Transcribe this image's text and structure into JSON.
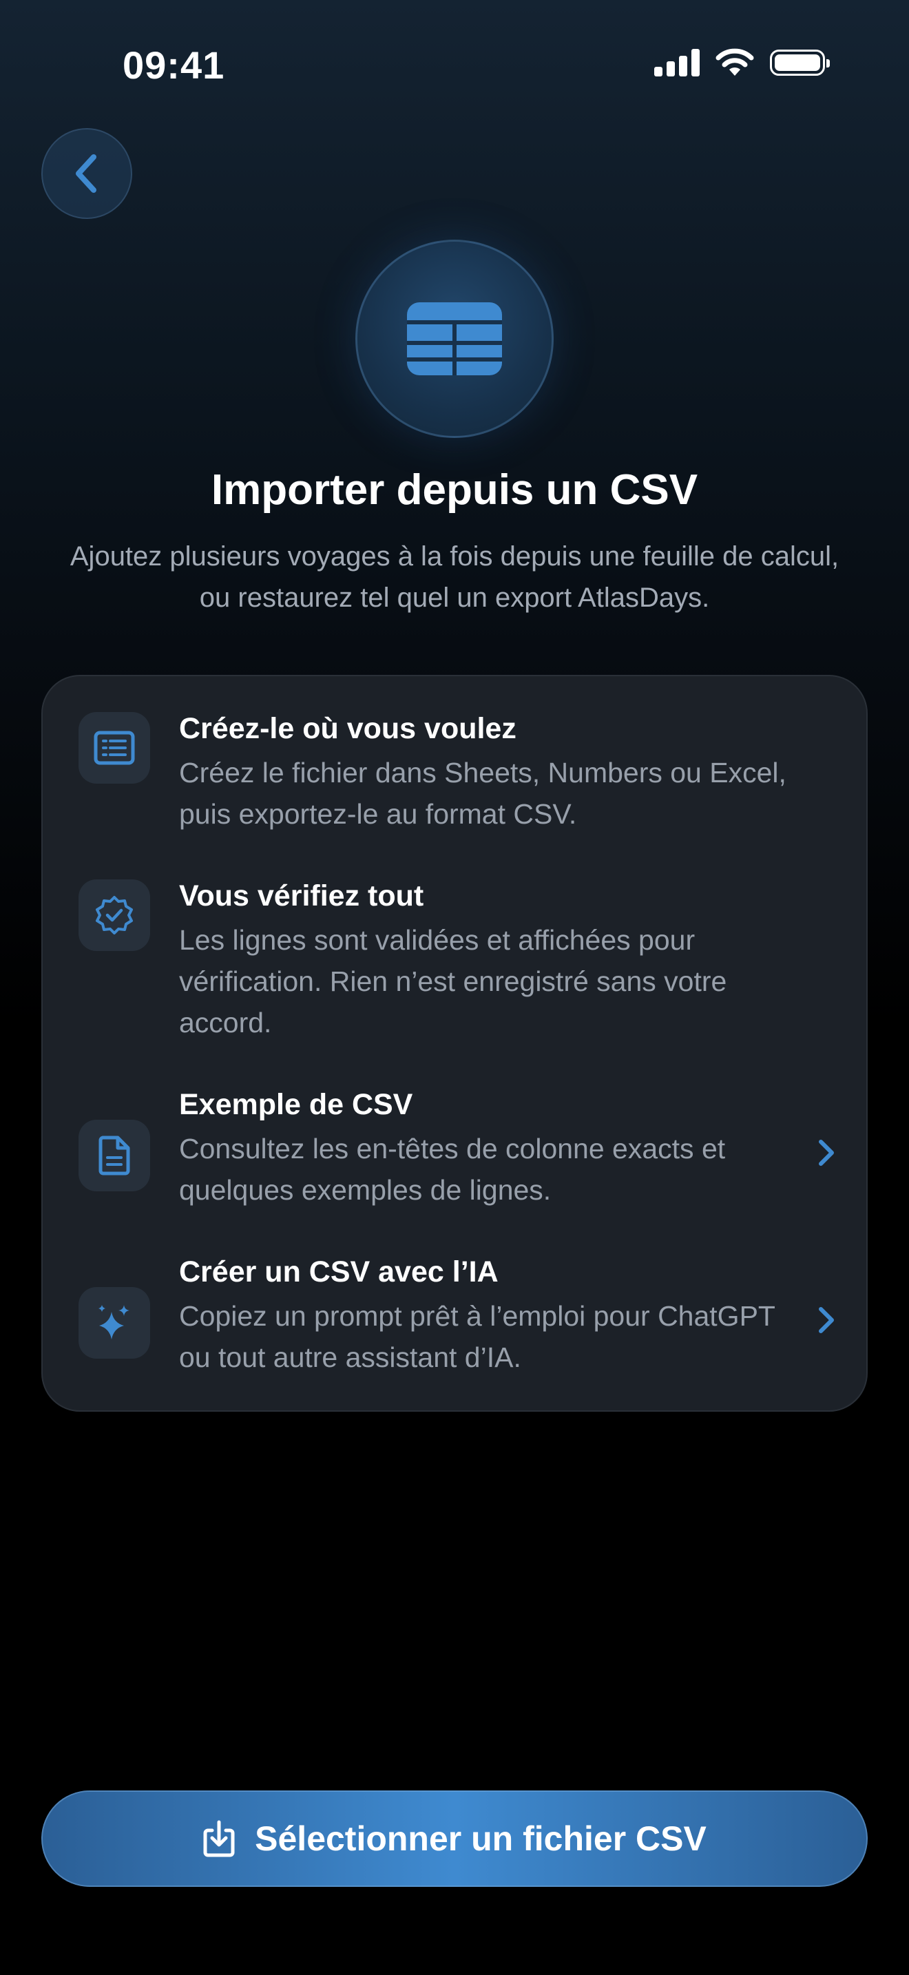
{
  "status_bar": {
    "time": "09:41"
  },
  "header": {
    "title": "Importer depuis un CSV",
    "subtitle": "Ajoutez plusieurs voyages à la fois depuis une feuille de calcul, ou restaurez tel quel un export AtlasDays."
  },
  "card": {
    "items": [
      {
        "title": "Créez-le où vous voulez",
        "description": "Créez le fichier dans Sheets, Numbers ou Excel, puis exportez-le au format CSV.",
        "icon": "list-document-icon",
        "has_chevron": false
      },
      {
        "title": "Vous vérifiez tout",
        "description": "Les lignes sont validées et affichées pour vérification. Rien n’est enregistré sans votre accord.",
        "icon": "verified-badge-icon",
        "has_chevron": false
      },
      {
        "title": "Exemple de CSV",
        "description": "Consultez les en-têtes de colonne exacts et quelques exemples de lignes.",
        "icon": "document-icon",
        "has_chevron": true
      },
      {
        "title": "Créer un CSV avec l’IA",
        "description": "Copiez un prompt prêt à l’emploi pour ChatGPT ou tout autre assistant d’IA.",
        "icon": "sparkles-icon",
        "has_chevron": true
      }
    ]
  },
  "cta": {
    "label": "Sélectionner un fichier CSV",
    "icon": "import-icon"
  },
  "colors": {
    "accent": "#3f8ad0",
    "card_bg": "#1c2128",
    "secondary_text": "#98a0ab"
  }
}
